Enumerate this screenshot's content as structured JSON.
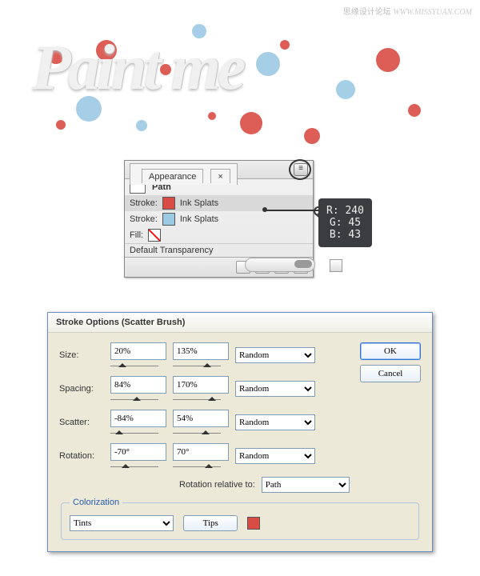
{
  "watermark": {
    "site": "思缘设计论坛",
    "url": "WWW.MISSYUAN.COM"
  },
  "artwork": {
    "text": "Paint me"
  },
  "appearance": {
    "title": "Appearance",
    "close": "×",
    "pathLabel": "Path",
    "rows": [
      {
        "label": "Stroke:",
        "name": "Ink Splats",
        "sw": "#d94b45"
      },
      {
        "label": "Stroke:",
        "name": "Ink Splats",
        "sw": "#9cc9e3"
      },
      {
        "label": "Fill:",
        "name": "",
        "sw": "none"
      }
    ],
    "defaultTransparency": "Default Transparency"
  },
  "colorTip": {
    "r": "R: 240",
    "g": "G:   45",
    "b": "B:   43"
  },
  "dialog": {
    "title": "Stroke Options (Scatter Brush)",
    "params": [
      {
        "label": "Size:",
        "lo": "20%",
        "hi": "135%",
        "mode": "Random"
      },
      {
        "label": "Spacing:",
        "lo": "84%",
        "hi": "170%",
        "mode": "Random"
      },
      {
        "label": "Scatter:",
        "lo": "-84%",
        "hi": "54%",
        "mode": "Random"
      },
      {
        "label": "Rotation:",
        "lo": "-70°",
        "hi": "70°",
        "mode": "Random"
      }
    ],
    "rotRelLabel": "Rotation relative to:",
    "rotRelValue": "Path",
    "colorization": {
      "legend": "Colorization",
      "method": "Tints",
      "tips": "Tips"
    },
    "ok": "OK",
    "cancel": "Cancel"
  }
}
